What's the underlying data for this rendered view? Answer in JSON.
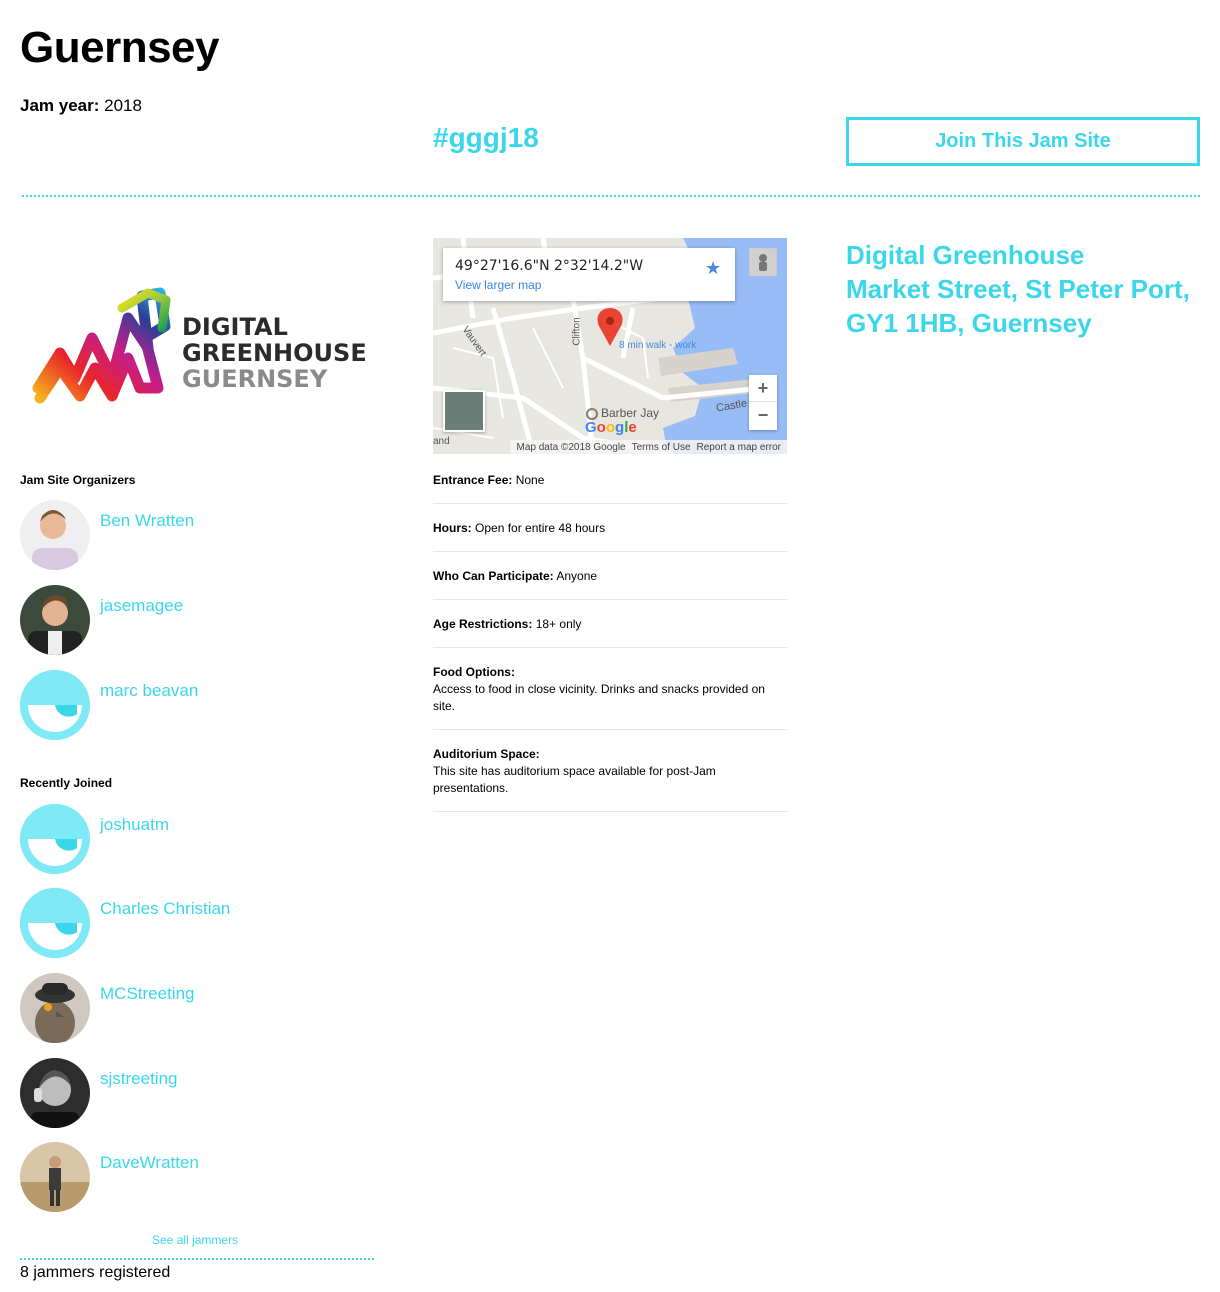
{
  "page": {
    "title": "Guernsey",
    "jam_year_label": "Jam year:",
    "jam_year": "2018"
  },
  "hashtag": "#gggj18",
  "join_button": "Join This Jam Site",
  "colors": {
    "accent": "#3ad7ea",
    "default_avatar": "#7fe9f5"
  },
  "logo": {
    "line1": "DIGITAL",
    "line2": "GREENHOUSE",
    "line3": "GUERNSEY"
  },
  "organizers": {
    "label": "Jam Site Organizers",
    "people": [
      {
        "name": "Ben Wratten",
        "avatar": "photo"
      },
      {
        "name": "jasemagee",
        "avatar": "photo"
      },
      {
        "name": "marc beavan",
        "avatar": "default"
      }
    ]
  },
  "recent": {
    "label": "Recently Joined",
    "people": [
      {
        "name": "joshuatm",
        "avatar": "default"
      },
      {
        "name": "Charles Christian",
        "avatar": "default"
      },
      {
        "name": "MCStreeting",
        "avatar": "photo"
      },
      {
        "name": "sjstreeting",
        "avatar": "photo"
      },
      {
        "name": "DaveWratten",
        "avatar": "photo"
      }
    ],
    "see_all": "See all jammers",
    "count_text": "8 jammers registered"
  },
  "map": {
    "coords": "49°27'16.6\"N 2°32'14.2\"W",
    "view_larger": "View larger map",
    "zoom_in": "+",
    "zoom_out": "−",
    "walk": "8 min walk - work",
    "poi": "Barber Jay",
    "street_castle": "Castle",
    "street_clifton": "Clifton",
    "street_vauvert": "Vauvert",
    "street_land": "and",
    "google": "Google",
    "footer": {
      "data": "Map data ©2018 Google",
      "terms": "Terms of Use",
      "report": "Report a map error"
    }
  },
  "info": [
    {
      "label": "Entrance Fee:",
      "value": "None",
      "block": false
    },
    {
      "label": "Hours:",
      "value": "Open for entire 48 hours",
      "block": false
    },
    {
      "label": "Who Can Participate:",
      "value": "Anyone",
      "block": false
    },
    {
      "label": "Age Restrictions:",
      "value": "18+ only",
      "block": false
    },
    {
      "label": "Food Options:",
      "value": "Access to food in close vicinity. Drinks and snacks provided on site.",
      "block": true
    },
    {
      "label": "Auditorium Space:",
      "value": "This site has auditorium space available for post-Jam presentations.",
      "block": true
    }
  ],
  "address": {
    "line1": "Digital Greenhouse",
    "line2": "Market Street, St Peter Port,",
    "line3": "GY1 1HB, Guernsey"
  }
}
